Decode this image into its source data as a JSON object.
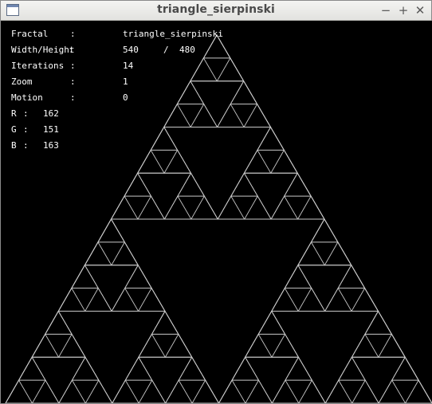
{
  "window": {
    "title": "triangle_sierpinski",
    "minimize_glyph": "−",
    "maximize_glyph": "+",
    "close_glyph": "✕"
  },
  "fractal": {
    "type": "sierpinski_triangle",
    "line_color": "#c8c8c8",
    "background": "#000000"
  },
  "info": {
    "fractal_label": "Fractal",
    "fractal_value": "triangle_sierpinski",
    "size_label": "Width/Height",
    "width": "540",
    "slash": "/",
    "height": "480",
    "iterations_label": "Iterations",
    "iterations_value": "14",
    "zoom_label": "Zoom",
    "zoom_value": "1",
    "motion_label": "Motion",
    "motion_value": "0",
    "r_label": "R",
    "r_value": "162",
    "g_label": "G",
    "g_value": "151",
    "b_label": "B",
    "b_value": "163",
    "colon": ":"
  },
  "colors": {
    "titlebar": "#ececea",
    "title_text": "#4a4a4a",
    "canvas_bg": "#000000",
    "text": "#ffffff"
  }
}
